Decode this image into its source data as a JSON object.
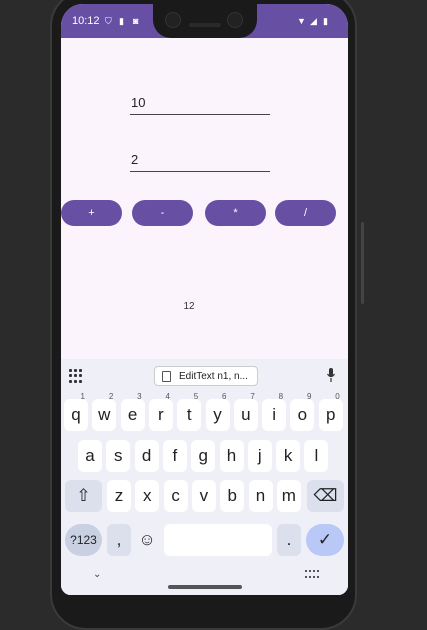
{
  "status": {
    "time": "10:12"
  },
  "inputs": {
    "num1": "10",
    "num2": "2"
  },
  "ops": [
    {
      "label": "+"
    },
    {
      "label": "-"
    },
    {
      "label": "*"
    },
    {
      "label": "/"
    }
  ],
  "result": "12",
  "keyboard": {
    "clipboard_label": "EditText n1, n...",
    "row1": [
      {
        "k": "q",
        "s": "1"
      },
      {
        "k": "w",
        "s": "2"
      },
      {
        "k": "e",
        "s": "3"
      },
      {
        "k": "r",
        "s": "4"
      },
      {
        "k": "t",
        "s": "5"
      },
      {
        "k": "y",
        "s": "6"
      },
      {
        "k": "u",
        "s": "7"
      },
      {
        "k": "i",
        "s": "8"
      },
      {
        "k": "o",
        "s": "9"
      },
      {
        "k": "p",
        "s": "0"
      }
    ],
    "row2": [
      "a",
      "s",
      "d",
      "f",
      "g",
      "h",
      "j",
      "k",
      "l"
    ],
    "row3": [
      "z",
      "x",
      "c",
      "v",
      "b",
      "n",
      "m"
    ],
    "sym_label": "?123",
    "comma": ",",
    "emoji": "☺",
    "period": ".",
    "shift": "⇧",
    "backspace": "⌫",
    "enter": "✓"
  }
}
